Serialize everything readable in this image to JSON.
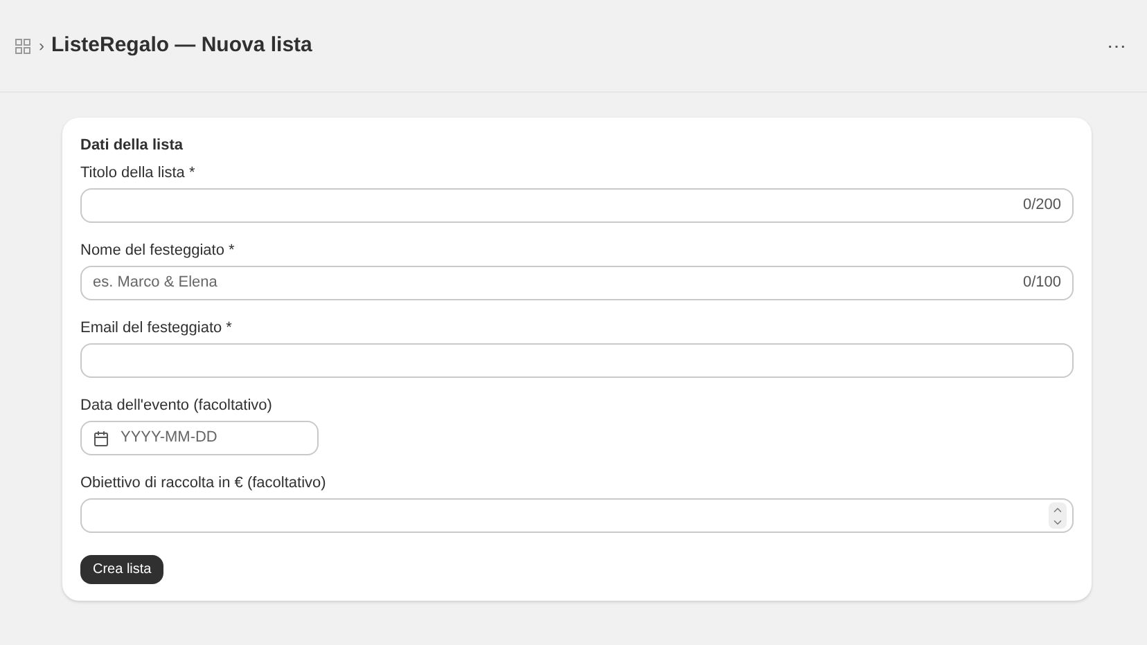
{
  "header": {
    "breadcrumb_separator": "›",
    "title": "ListeRegalo — Nuova lista",
    "menu": "⋯"
  },
  "card": {
    "heading": "Dati della lista",
    "fields": [
      {
        "kind": "text",
        "label": "Titolo della lista *",
        "counter": "0/200"
      },
      {
        "kind": "text",
        "label": "Nome del festeggiato *",
        "placeholder": "es. Marco & Elena",
        "counter": "0/100"
      },
      {
        "kind": "text",
        "label": "Email del festeggiato *"
      },
      {
        "kind": "date",
        "label": "Data dell'evento (facoltativo)",
        "placeholder": "YYYY-MM-DD"
      },
      {
        "kind": "number",
        "label": "Obiettivo di raccolta in € (facoltativo)"
      }
    ],
    "button": "Crea lista"
  }
}
